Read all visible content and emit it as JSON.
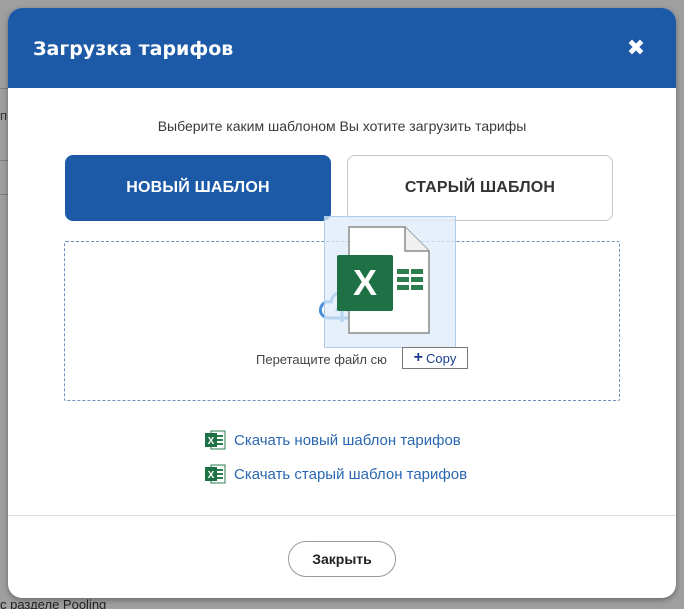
{
  "background": {
    "side_text": "п",
    "bottom_text": "с разделе Pooling"
  },
  "modal": {
    "title": "Загрузка тарифов",
    "close_icon": "close-icon",
    "prompt": "Выберите каким шаблоном Вы хотите загрузить тарифы",
    "templates": {
      "new_label": "НОВЫЙ ШАБЛОН",
      "old_label": "СТАРЫЙ ШАБЛОН",
      "selected": "new"
    },
    "dropzone": {
      "text": "Перетащите файл сю",
      "icon": "cloud-upload-icon"
    },
    "drag": {
      "file_icon": "excel-file-icon",
      "badge_label": "Copy"
    },
    "downloads": {
      "new_label": "Скачать новый шаблон тарифов",
      "old_label": "Скачать старый шаблон тарифов",
      "icon": "excel-icon"
    },
    "footer": {
      "close_label": "Закрыть"
    }
  },
  "colors": {
    "header": "#1c59a6",
    "primary_button": "#1c59a6",
    "link": "#2a67b1",
    "excel_green": "#1e7145"
  }
}
